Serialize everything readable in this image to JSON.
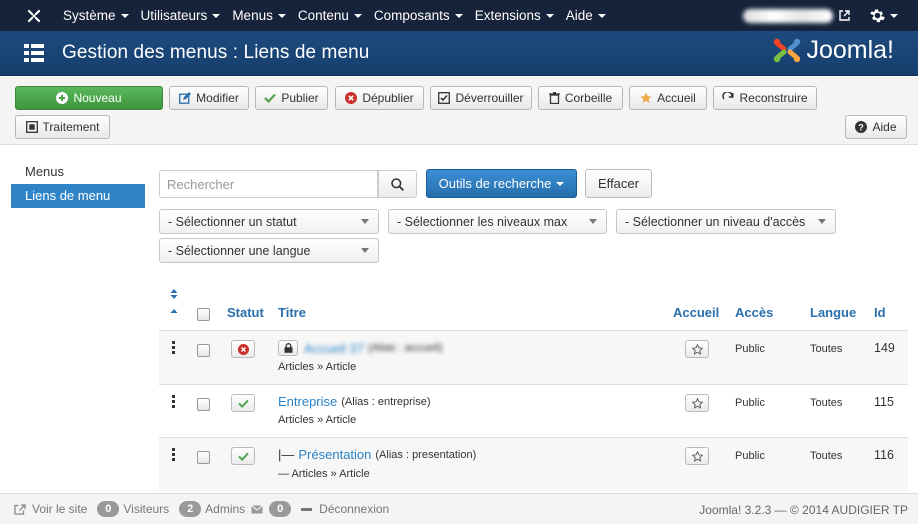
{
  "navbar": {
    "menus": [
      "Système",
      "Utilisateurs",
      "Menus",
      "Contenu",
      "Composants",
      "Extensions",
      "Aide"
    ]
  },
  "header": {
    "title": "Gestion des menus : Liens de menu",
    "brand": "Joomla!"
  },
  "toolbar": {
    "new": "Nouveau",
    "edit": "Modifier",
    "publish": "Publier",
    "unpublish": "Dépublier",
    "checkin": "Déverrouiller",
    "trash": "Corbeille",
    "home": "Accueil",
    "rebuild": "Reconstruire",
    "batch": "Traitement",
    "help": "Aide"
  },
  "sidebar": {
    "items": [
      {
        "label": "Menus",
        "active": false
      },
      {
        "label": "Liens de menu",
        "active": true
      }
    ]
  },
  "filters": {
    "search_placeholder": "Rechercher",
    "search_tools": "Outils de recherche",
    "clear": "Effacer",
    "status": "- Sélectionner un statut",
    "levels": "- Sélectionner les niveaux max",
    "access": "- Sélectionner un niveau d'accès",
    "language": "- Sélectionner une langue"
  },
  "table": {
    "headers": {
      "status": "Statut",
      "title": "Titre",
      "home": "Accueil",
      "access": "Accès",
      "language": "Langue",
      "id": "Id"
    },
    "rows": [
      {
        "prefix": "",
        "title": "Accueil 37",
        "alias": "(Alias : accueil)",
        "type": "Articles » Article",
        "access": "Public",
        "language": "Toutes",
        "id": "149",
        "status": "unpublished",
        "locked": true
      },
      {
        "prefix": "",
        "title": "Entreprise",
        "alias": "(Alias : entreprise)",
        "type": "Articles » Article",
        "access": "Public",
        "language": "Toutes",
        "id": "115",
        "status": "published",
        "locked": false
      },
      {
        "prefix": "|—",
        "title": "Présentation",
        "alias": "(Alias : presentation)",
        "type": "— Articles » Article",
        "access": "Public",
        "language": "Toutes",
        "id": "116",
        "status": "published",
        "locked": false
      }
    ]
  },
  "footer": {
    "view_site": "Voir le site",
    "visitors_count": "0",
    "visitors": "Visiteurs",
    "admins_count": "2",
    "admins": "Admins",
    "messages_count": "0",
    "logout": "Déconnexion",
    "version": "Joomla! 3.2.3 — © 2014 AUDIGIER TP"
  },
  "colors": {
    "navbar": "#17233a",
    "header": "#1d4a7e",
    "link": "#2a84c7",
    "success": "#5cb85c",
    "primary": "#2f84c7",
    "danger": "#c9302c"
  }
}
